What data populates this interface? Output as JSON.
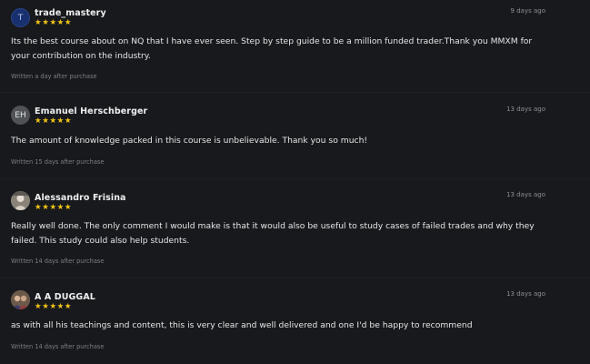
{
  "reviews": [
    {
      "avatar": "T",
      "avatar_type": "letter",
      "author": "trade_mastery",
      "rating": 5,
      "stars": "★★★★★",
      "date": "9 days ago",
      "text": "Its the best course about on NQ that I have ever seen. Step by step guide to be a million funded trader.Thank you MMXM for your contribution on the industry.",
      "meta": "Written a day after purchase"
    },
    {
      "avatar": "EH",
      "avatar_type": "initials",
      "author": "Emanuel Herschberger",
      "rating": 5,
      "stars": "★★★★★",
      "date": "13 days ago",
      "text": "The amount of knowledge packed in this course is unbelievable. Thank you so much!",
      "meta": "Written 15 days after purchase"
    },
    {
      "avatar": "",
      "avatar_type": "photo",
      "author": "Alessandro Frisina",
      "rating": 5,
      "stars": "★★★★★",
      "date": "13 days ago",
      "text": "Really well done. The only comment I would make is that it would also be useful to study cases of failed trades and why they failed. This study could also help students.",
      "meta": "Written 14 days after purchase"
    },
    {
      "avatar": "",
      "avatar_type": "photo",
      "author": "A A DUGGAL",
      "rating": 5,
      "stars": "★★★★★",
      "date": "13 days ago",
      "text": "as with all his teachings and content, this is very clear and well delivered and one I'd be happy to recommend",
      "meta": "Written 14 days after purchase"
    }
  ],
  "colors": {
    "background": "#18191c",
    "star": "#f5c518",
    "text": "#e6e6e8",
    "muted": "#8d8f94"
  }
}
